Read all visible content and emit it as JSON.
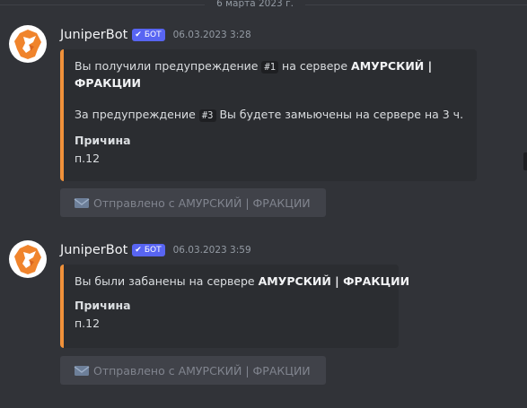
{
  "divider": {
    "date": "6 марта 2023 г."
  },
  "messages": [
    {
      "username": "JuniperBot",
      "bot_tag": "БОТ",
      "timestamp": "06.03.2023 3:28",
      "embed": {
        "line1_pre": "Вы получили предупреждение ",
        "line1_code": "#1",
        "line1_mid": " на сервере ",
        "line1_bold_a": "АМУРСКИЙ |",
        "line1_bold_b": "ФРАКЦИИ",
        "line2_pre": "За предупреждение ",
        "line2_code": "#3",
        "line2_post": " Вы будете замьючены на сервере на 3 ч.",
        "field_name": "Причина",
        "field_value": "п.12"
      },
      "button_label": "Отправлено с АМУРСКИЙ | ФРАКЦИИ"
    },
    {
      "username": "JuniperBot",
      "bot_tag": "БОТ",
      "timestamp": "06.03.2023 3:59",
      "embed": {
        "line1_pre": "Вы были забанены на сервере ",
        "line1_bold": "АМУРСКИЙ | ФРАКЦИИ",
        "field_name": "Причина",
        "field_value": "п.12"
      },
      "button_label": "Отправлено с АМУРСКИЙ | ФРАКЦИИ"
    }
  ],
  "colors": {
    "background": "#313338",
    "embed_background": "#2b2d31",
    "embed_border": "#f0913a",
    "bot_tag": "#5865f2",
    "button": "#404249"
  },
  "icons": {
    "avatar": "fox-logo-icon",
    "bot_check": "check-icon",
    "button": "envelope-icon"
  }
}
